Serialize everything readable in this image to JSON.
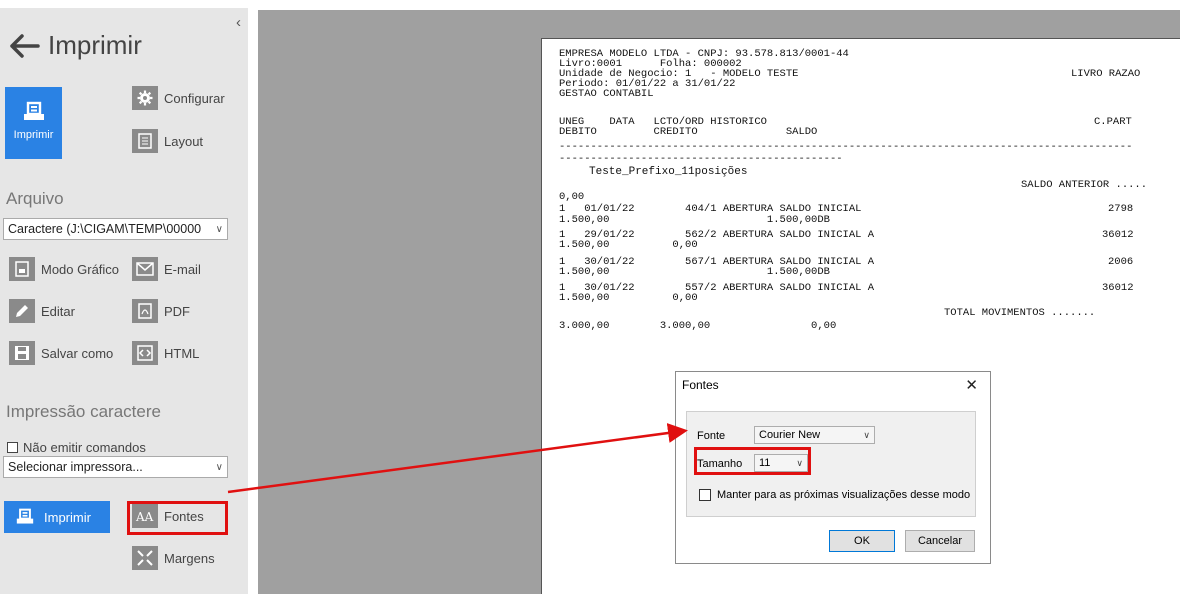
{
  "sidebar": {
    "title": "Imprimir",
    "imprimir_big_label": "Imprimir",
    "configurar_label": "Configurar",
    "layout_label": "Layout",
    "arquivo_header": "Arquivo",
    "arquivo_select_value": "Caractere (J:\\CIGAM\\TEMP\\00000",
    "modo_grafico_label": "Modo Gráfico",
    "email_label": "E-mail",
    "editar_label": "Editar",
    "pdf_label": "PDF",
    "salvar_como_label": "Salvar como",
    "html_label": "HTML",
    "impressao_header": "Impressão caractere",
    "nao_emitir_label": "Não emitir comandos",
    "printer_select_value": "Selecionar impressora...",
    "print_button_label": "Imprimir",
    "fontes_label": "Fontes",
    "margens_label": "Margens"
  },
  "report": {
    "header_lines": [
      "EMPRESA MODELO LTDA - CNPJ: 93.578.813/0001-44",
      "Livro:0001      Folha: 000002",
      "Unidade de Negocio: 1   - MODELO TESTE",
      "Periodo: 01/01/22 a 31/01/22",
      "GESTAO CONTABIL"
    ],
    "livro_razao": "LIVRO RAZAO",
    "col_header_line1": "UNEG    DATA   LCTO/ORD HISTORICO",
    "col_header_line2": "DEBITO         CREDITO              SALDO",
    "col_cpart": "C.PART",
    "dash_line1": "-------------------------------------------------------------------------------------------",
    "dash_line2": "---------------------------------------------",
    "account_name": "Teste_Prefixo_11posições",
    "saldo_anterior": "SALDO ANTERIOR .....",
    "saldo_inicial_value": "0,00",
    "entries": [
      {
        "line1": "1   01/01/22        404/1 ABERTURA SALDO INICIAL",
        "cpart": "2798",
        "line2": "1.500,00                         1.500,00DB"
      },
      {
        "line1": "1   29/01/22        562/2 ABERTURA SALDO INICIAL A",
        "cpart": "36012",
        "line2": "1.500,00          0,00"
      },
      {
        "line1": "1   30/01/22        567/1 ABERTURA SALDO INICIAL A",
        "cpart": "2006",
        "line2": "1.500,00                         1.500,00DB"
      },
      {
        "line1": "1   30/01/22        557/2 ABERTURA SALDO INICIAL A",
        "cpart": "36012",
        "line2": "1.500,00          0,00"
      }
    ],
    "total_label": "TOTAL MOVIMENTOS .......",
    "total_line": "3.000,00        3.000,00                0,00"
  },
  "dialog": {
    "title": "Fontes",
    "close_glyph": "✕",
    "fonte_label": "Fonte",
    "fonte_value": "Courier New",
    "tamanho_label": "Tamanho",
    "tamanho_value": "11",
    "manter_label": "Manter para as próximas visualizações desse modo",
    "ok_label": "OK",
    "cancel_label": "Cancelar"
  },
  "glyphs": {
    "collapse": "‹",
    "caret": "∨"
  },
  "colors": {
    "accent_blue": "#2a82e4",
    "highlight_red": "#e01010",
    "sidebar_bg": "#e6e6e6",
    "preview_gray": "#a0a0a0"
  },
  "icons": [
    "back-arrow-icon",
    "printer-icon",
    "gear-icon",
    "document-icon",
    "graphic-mode-icon",
    "email-icon",
    "pencil-icon",
    "pdf-icon",
    "save-icon",
    "html-icon",
    "font-icon",
    "margins-icon",
    "close-icon"
  ]
}
